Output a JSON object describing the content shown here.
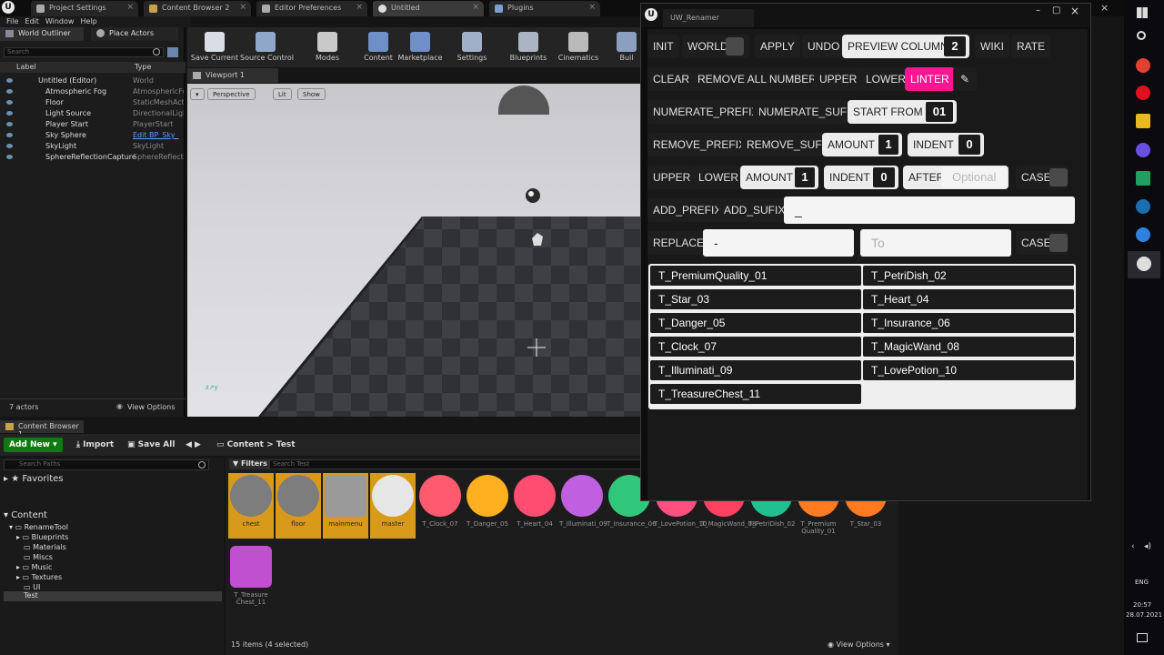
{
  "tabs": [
    "Project Settings",
    "Content Browser 2",
    "Editor Preferences",
    "Untitled",
    "Plugins"
  ],
  "menu": [
    "File",
    "Edit",
    "Window",
    "Help"
  ],
  "outliner": {
    "tab_title": "World Outliner",
    "tab2_title": "Place Actors",
    "search_placeholder": "Search",
    "col_label": "Label",
    "col_type": "Type",
    "rows": [
      {
        "name": "Untitled (Editor)",
        "type": "World"
      },
      {
        "name": "Atmospheric Fog",
        "type": "AtmosphericFo"
      },
      {
        "name": "Floor",
        "type": "StaticMeshAct"
      },
      {
        "name": "Light Source",
        "type": "DirectionalLigl"
      },
      {
        "name": "Player Start",
        "type": "PlayerStart"
      },
      {
        "name": "Sky Sphere",
        "type": "Edit BP_Sky_"
      },
      {
        "name": "SkyLight",
        "type": "SkyLight"
      },
      {
        "name": "SphereReflectionCapture",
        "type": "SphereReflecti"
      }
    ],
    "actor_count": "7 actors",
    "view_options": "View Options"
  },
  "toolbar": [
    {
      "label": "Save Current",
      "color": "#d8dde6"
    },
    {
      "label": "Source Control",
      "color": "#8fa7c9"
    },
    {
      "label": "Modes",
      "color": "#c9c9c9"
    },
    {
      "label": "Content",
      "color": "#6f8fc8"
    },
    {
      "label": "Marketplace",
      "color": "#6f8fc8"
    },
    {
      "label": "Settings",
      "color": "#9fb0c8"
    },
    {
      "label": "Blueprints",
      "color": "#aab4c2"
    },
    {
      "label": "Cinematics",
      "color": "#b9b9b9"
    },
    {
      "label": "Buil",
      "color": "#8aa0c0"
    }
  ],
  "viewport": {
    "tab": "Viewport 1",
    "perspective": "Perspective",
    "lit": "Lit",
    "show": "Show"
  },
  "content_browser": {
    "tab": "Content Browser 1",
    "add_new": "Add New",
    "import": "Import",
    "save_all": "Save All",
    "path_root": "Content",
    "path_sep": ">",
    "path_leaf": "Test",
    "search_paths": "Search Paths",
    "filters": "Filters",
    "search_test": "Search Test",
    "favorites": "Favorites",
    "tree": [
      "Content",
      "RenameTool",
      "Blueprints",
      "Materials",
      "Miscs",
      "Music",
      "Textures",
      "UI",
      "Test"
    ],
    "assets": [
      {
        "label": "chest",
        "selected": true,
        "color": "#7d7d7d"
      },
      {
        "label": "floor",
        "selected": true,
        "color": "#7d7d7d"
      },
      {
        "label": "mainmenu",
        "selected": true,
        "color": "#9a9a9a"
      },
      {
        "label": "master",
        "selected": true,
        "color": "#e6e6e6"
      },
      {
        "label": "T_Clock_07",
        "selected": false,
        "color": "#ff5a6e"
      },
      {
        "label": "T_Danger_05",
        "selected": false,
        "color": "#ffb020"
      },
      {
        "label": "T_Heart_04",
        "selected": false,
        "color": "#ff4d72"
      },
      {
        "label": "T_Illuminati_09",
        "selected": false,
        "color": "#c060e0"
      },
      {
        "label": "T_Insurance_06",
        "selected": false,
        "color": "#30c878"
      },
      {
        "label": "T_LovePotion_10",
        "selected": false,
        "color": "#ff5080"
      },
      {
        "label": "T_MagicWand_08",
        "selected": false,
        "color": "#ff4060"
      },
      {
        "label": "T_PetriDish_02",
        "selected": false,
        "color": "#20c090"
      },
      {
        "label": "T_Premium Quality_01",
        "selected": false,
        "color": "#ff7a20"
      },
      {
        "label": "T_Star_03",
        "selected": false,
        "color": "#ff7a20"
      },
      {
        "label": "T_Treasure Chest_11",
        "selected": false,
        "color": "#c050d0"
      }
    ],
    "status": "15 items (4 selected)",
    "view_options": "View Options"
  },
  "renamer": {
    "title": "UW_Renamer",
    "init": "INIT",
    "world": "WORLD",
    "apply": "APPLY",
    "undo": "UNDO",
    "preview_columns": "PREVIEW COLUMNS",
    "preview_columns_value": "2",
    "wiki": "WIKI",
    "rate": "RATE",
    "clear": "CLEAR",
    "remove_all_numbers": "REMOVE ALL NUMBERS",
    "upper": "UPPER",
    "lower": "LOWER",
    "linter": "LINTER",
    "numerate_prefix": "NUMERATE_PREFIX",
    "numerate_sufix": "NUMERATE_SUFIX",
    "start_from": "START FROM",
    "start_from_value": "01",
    "remove_prefix": "REMOVE_PREFIX",
    "remove_sufix": "REMOVE_SUFIX",
    "amount": "AMOUNT",
    "amount_value": "1",
    "indent": "INDENT",
    "indent_value": "0",
    "upper2": "UPPER",
    "lower2": "LOWER",
    "amount2": "AMOUNT",
    "amount2_value": "1",
    "indent2": "INDENT",
    "indent2_value": "0",
    "after": "AFTER",
    "after_placeholder": "Optional",
    "case": "CASE",
    "add_prefix": "ADD_PREFIX",
    "add_sufix": "ADD_SUFIX",
    "add_value": "_",
    "replace": "REPLACE",
    "replace_from": "-",
    "replace_to_placeholder": "To",
    "case2": "CASE",
    "accent": "#ff1592",
    "preview": [
      "T_PremiumQuality_01",
      "T_PetriDish_02",
      "T_Star_03",
      "T_Heart_04",
      "T_Danger_05",
      "T_Insurance_06",
      "T_Clock_07",
      "T_MagicWand_08",
      "T_Illuminati_09",
      "T_LovePotion_10",
      "T_TreasureChest_11"
    ]
  },
  "taskbar": {
    "lang": "ENG",
    "time": "20:57",
    "date": "28.07.2021"
  }
}
